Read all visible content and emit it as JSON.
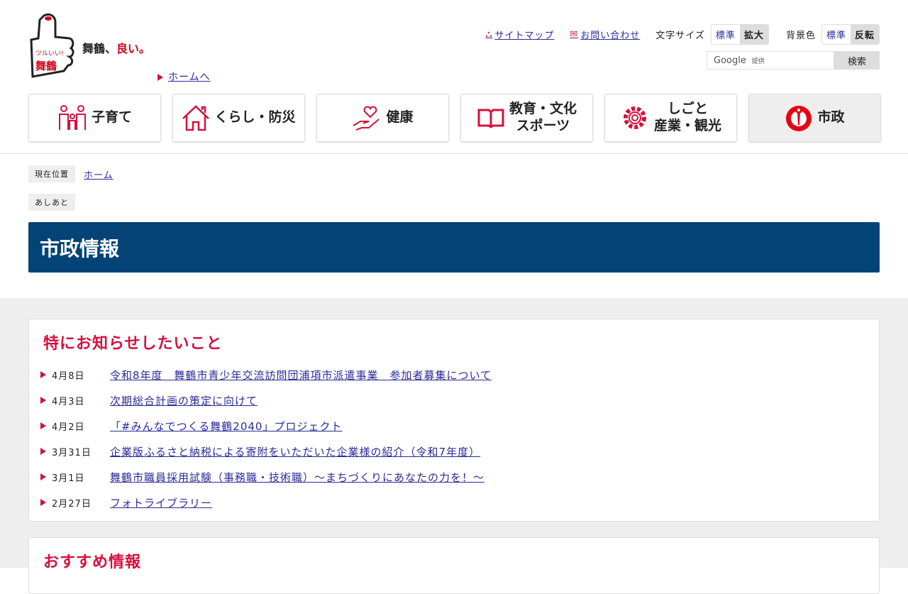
{
  "logo": {
    "tagline_a": "舞鶴、",
    "tagline_b": "良い。",
    "mark_text": "ツルいい！舞鶴"
  },
  "home_link": "ホームへ",
  "util": {
    "sitemap": "サイトマップ",
    "contact": "お問い合わせ",
    "font_size_label": "文字サイズ",
    "font_std": "標準",
    "font_large": "拡大",
    "bg_label": "背景色",
    "bg_std": "標準",
    "bg_invert": "反転"
  },
  "search": {
    "placeholder_brand": "Google",
    "placeholder_sub": "提供",
    "button": "検索"
  },
  "nav": [
    {
      "l1": "子育て",
      "icon": "family-icon"
    },
    {
      "l1": "くらし・防災",
      "icon": "house-icon"
    },
    {
      "l1": "健康",
      "icon": "heart-hand-icon"
    },
    {
      "l1": "教育・文化",
      "l2": "スポーツ",
      "icon": "book-icon"
    },
    {
      "l1": "しごと",
      "l2": "産業・観光",
      "icon": "gear-icon"
    },
    {
      "l1": "市政",
      "icon": "city-emblem-icon"
    }
  ],
  "breadcrumb": {
    "label": "現在位置",
    "home": "ホーム"
  },
  "footprints": {
    "label": "あしあと"
  },
  "page_title": "市政情報",
  "notice": {
    "heading": "特にお知らせしたいこと",
    "items": [
      {
        "date": "4月8日",
        "text": "令和8年度　舞鶴市青少年交流訪問団浦項市派遣事業　参加者募集について"
      },
      {
        "date": "4月3日",
        "text": "次期総合計画の策定に向けて"
      },
      {
        "date": "4月2日",
        "text": "「#みんなでつくる舞鶴2040」プロジェクト"
      },
      {
        "date": "3月31日",
        "text": "企業版ふるさと納税による寄附をいただいた企業様の紹介（令和7年度）"
      },
      {
        "date": "3月1日",
        "text": "舞鶴市職員採用試験（事務職・技術職）～まちづくりにあなたの力を！～"
      },
      {
        "date": "2月27日",
        "text": "フォトライブラリー"
      }
    ]
  },
  "recommend": {
    "heading": "おすすめ情報"
  }
}
